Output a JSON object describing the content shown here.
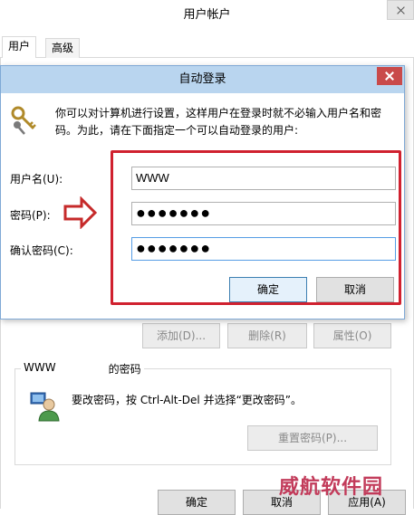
{
  "outer": {
    "title": "用户帐户",
    "tabs": [
      {
        "label": "用户"
      },
      {
        "label": "高级"
      }
    ],
    "buttons": {
      "add": "添加(D)...",
      "remove": "删除(R)",
      "properties": "属性(O)"
    },
    "password_group": {
      "username_prefix": "WWW",
      "title_suffix": "的密码",
      "text": "要改密码，按 Ctrl-Alt-Del 并选择“更改密码”。",
      "reset_button": "重置密码(P)..."
    },
    "footer": {
      "ok": "确定",
      "cancel": "取消",
      "apply": "应用(A)"
    }
  },
  "dialog": {
    "title": "自动登录",
    "instructions": "你可以对计算机进行设置，这样用户在登录时就不必输入用户名和密码。为此，请在下面指定一个可以自动登录的用户:",
    "fields": [
      {
        "label": "用户名(U):",
        "value": "WWW"
      },
      {
        "label": "密码(P):",
        "value": "●●●●●●●"
      },
      {
        "label": "确认密码(C):",
        "value": "●●●●●●●"
      }
    ],
    "ok_button": "确定",
    "cancel_button": "取消"
  },
  "watermark": "威航软件园",
  "colors": {
    "highlight": "#d0212f",
    "dialog_titlebar": "#b9d5ef",
    "close_button": "#c94a4a"
  }
}
